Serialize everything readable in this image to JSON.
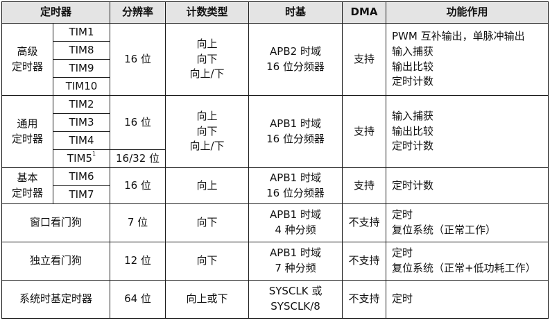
{
  "headers": [
    "定时器",
    "分辨率",
    "计数类型",
    "时基",
    "DMA",
    "功能作用"
  ],
  "advanced": {
    "category": [
      "高级",
      "定时器"
    ],
    "timers": [
      "TIM1",
      "TIM8",
      "TIM9",
      "TIM10"
    ],
    "resolution": "16 位",
    "count": [
      "向上",
      "向下",
      "向上/下"
    ],
    "clock": [
      "APB2 时域",
      "16 位分频器"
    ],
    "dma": "支持",
    "functions": [
      "PWM 互补输出，单脉冲输出",
      "输入捕获",
      "输出比较",
      "定时计数"
    ]
  },
  "general": {
    "category": [
      "通用",
      "定时器"
    ],
    "timers": [
      "TIM2",
      "TIM3",
      "TIM4",
      "TIM5"
    ],
    "tim5_note": "1",
    "resolution": "16 位",
    "resolution_tim5": "16/32 位",
    "count": [
      "向上",
      "向下",
      "向上/下"
    ],
    "clock": [
      "APB1 时域",
      "16 位分频器"
    ],
    "dma": "支持",
    "functions": [
      "输入捕获",
      "输出比较",
      "定时计数"
    ]
  },
  "basic": {
    "category": [
      "基本",
      "定时器"
    ],
    "timers": [
      "TIM6",
      "TIM7"
    ],
    "resolution": "16 位",
    "count": "向上",
    "clock": [
      "APB1 时域",
      "16 位分频器"
    ],
    "dma": "支持",
    "functions": [
      "定时计数"
    ]
  },
  "window_wdg": {
    "name": "窗口看门狗",
    "resolution": "7 位",
    "count": "向下",
    "clock": [
      "APB1 时域",
      "4 种分频"
    ],
    "dma": "不支持",
    "functions": [
      "定时",
      "复位系统（正常工作）"
    ]
  },
  "independent_wdg": {
    "name": "独立看门狗",
    "resolution": "12 位",
    "count": "向下",
    "clock": [
      "APB1 时域",
      "7 种分频"
    ],
    "dma": "不支持",
    "functions": [
      "定时",
      "复位系统（正常+低功耗工作）"
    ]
  },
  "systick": {
    "name": "系统时基定时器",
    "resolution": "64 位",
    "count": "向上或下",
    "clock": [
      "SYSCLK 或",
      "SYSCLK/8"
    ],
    "dma": "不支持",
    "functions": [
      "定时"
    ]
  }
}
